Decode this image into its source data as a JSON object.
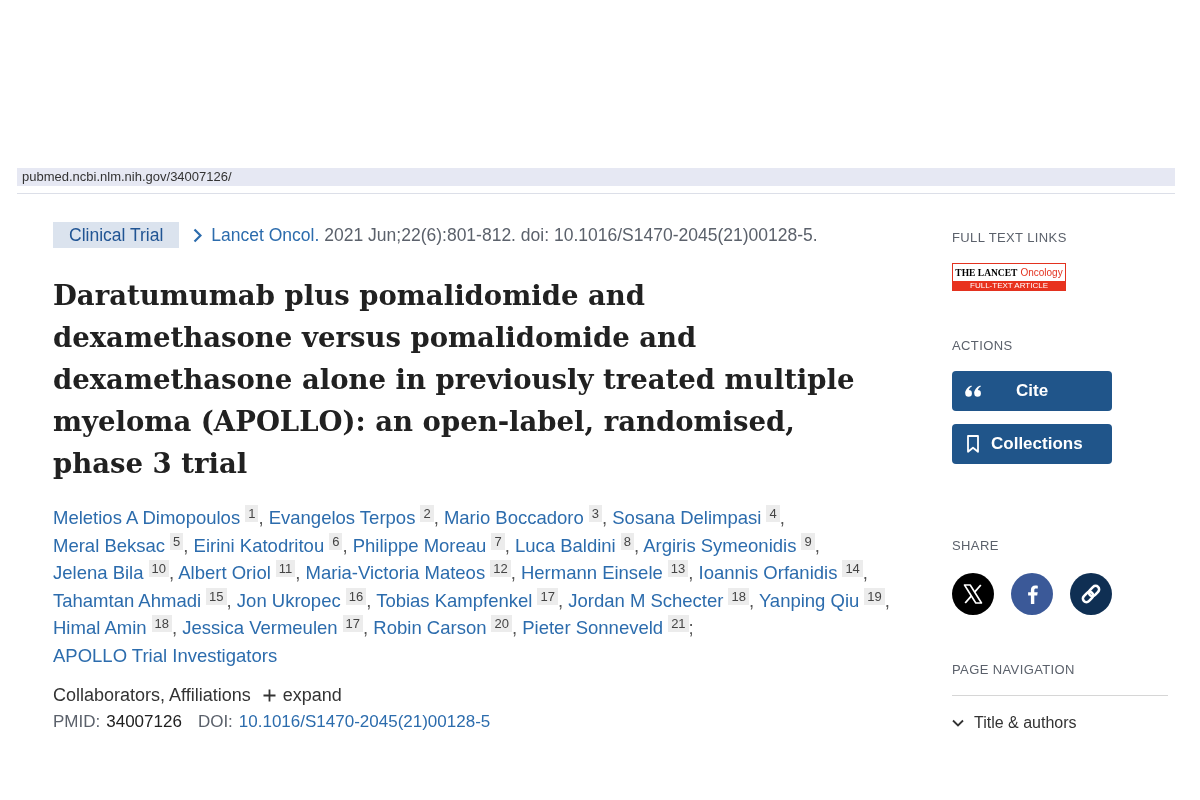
{
  "address_bar": {
    "url": "pubmed.ncbi.nlm.nih.gov/34007126/"
  },
  "article": {
    "publication_type": "Clinical Trial",
    "journal": "Lancet Oncol.",
    "citation": "2021 Jun;22(6):801-812. doi: 10.1016/S1470-2045(21)00128-5.",
    "title": "Daratumumab plus pomalidomide and dexamethasone versus pomalidomide and dexamethasone alone in previously treated multiple myeloma (APOLLO): an open-label, randomised, phase 3 trial",
    "authors": [
      {
        "name": "Meletios A Dimopoulos",
        "affiliation": "1",
        "separator": ","
      },
      {
        "name": "Evangelos Terpos",
        "affiliation": "2",
        "separator": ","
      },
      {
        "name": "Mario Boccadoro",
        "affiliation": "3",
        "separator": ","
      },
      {
        "name": "Sosana Delimpasi",
        "affiliation": "4",
        "separator": ","
      },
      {
        "name": "Meral Beksac",
        "affiliation": "5",
        "separator": ","
      },
      {
        "name": "Eirini Katodritou",
        "affiliation": "6",
        "separator": ","
      },
      {
        "name": "Philippe Moreau",
        "affiliation": "7",
        "separator": ","
      },
      {
        "name": "Luca Baldini",
        "affiliation": "8",
        "separator": ","
      },
      {
        "name": "Argiris Symeonidis",
        "affiliation": "9",
        "separator": ","
      },
      {
        "name": "Jelena Bila",
        "affiliation": "10",
        "separator": ","
      },
      {
        "name": "Albert Oriol",
        "affiliation": "11",
        "separator": ","
      },
      {
        "name": "Maria-Victoria Mateos",
        "affiliation": "12",
        "separator": ","
      },
      {
        "name": "Hermann Einsele",
        "affiliation": "13",
        "separator": ","
      },
      {
        "name": "Ioannis Orfanidis",
        "affiliation": "14",
        "separator": ","
      },
      {
        "name": "Tahamtan Ahmadi",
        "affiliation": "15",
        "separator": ","
      },
      {
        "name": "Jon Ukropec",
        "affiliation": "16",
        "separator": ","
      },
      {
        "name": "Tobias Kampfenkel",
        "affiliation": "17",
        "separator": ","
      },
      {
        "name": "Jordan M Schecter",
        "affiliation": "18",
        "separator": ","
      },
      {
        "name": "Yanping Qiu",
        "affiliation": "19",
        "separator": ","
      },
      {
        "name": "Himal Amin",
        "affiliation": "18",
        "separator": ","
      },
      {
        "name": "Jessica Vermeulen",
        "affiliation": "17",
        "separator": ","
      },
      {
        "name": "Robin Carson",
        "affiliation": "20",
        "separator": ","
      },
      {
        "name": "Pieter Sonneveld",
        "affiliation": "21",
        "separator": ";"
      }
    ],
    "collective": "APOLLO Trial Investigators",
    "collaborators_label": "Collaborators, Affiliations",
    "expand_label": "expand",
    "identifiers": [
      {
        "label": "PMID:",
        "value": "34007126",
        "link": false
      },
      {
        "label": "DOI:",
        "value": "10.1016/S1470-2045(21)00128-5",
        "link": true
      }
    ]
  },
  "sidebar": {
    "full_text_links": {
      "heading": "FULL TEXT LINKS",
      "logo": {
        "brand": "THE LANCET",
        "journal": "Oncology",
        "caption": "FULL-TEXT ARTICLE"
      }
    },
    "actions": {
      "heading": "ACTIONS",
      "buttons": [
        {
          "kind": "cite",
          "label": "Cite"
        },
        {
          "kind": "collections",
          "label": "Collections"
        }
      ]
    },
    "share": {
      "heading": "SHARE",
      "links": [
        {
          "kind": "x"
        },
        {
          "kind": "facebook"
        },
        {
          "kind": "link"
        }
      ]
    },
    "page_navigation": {
      "heading": "PAGE NAVIGATION",
      "items": [
        "Title & authors"
      ]
    }
  }
}
